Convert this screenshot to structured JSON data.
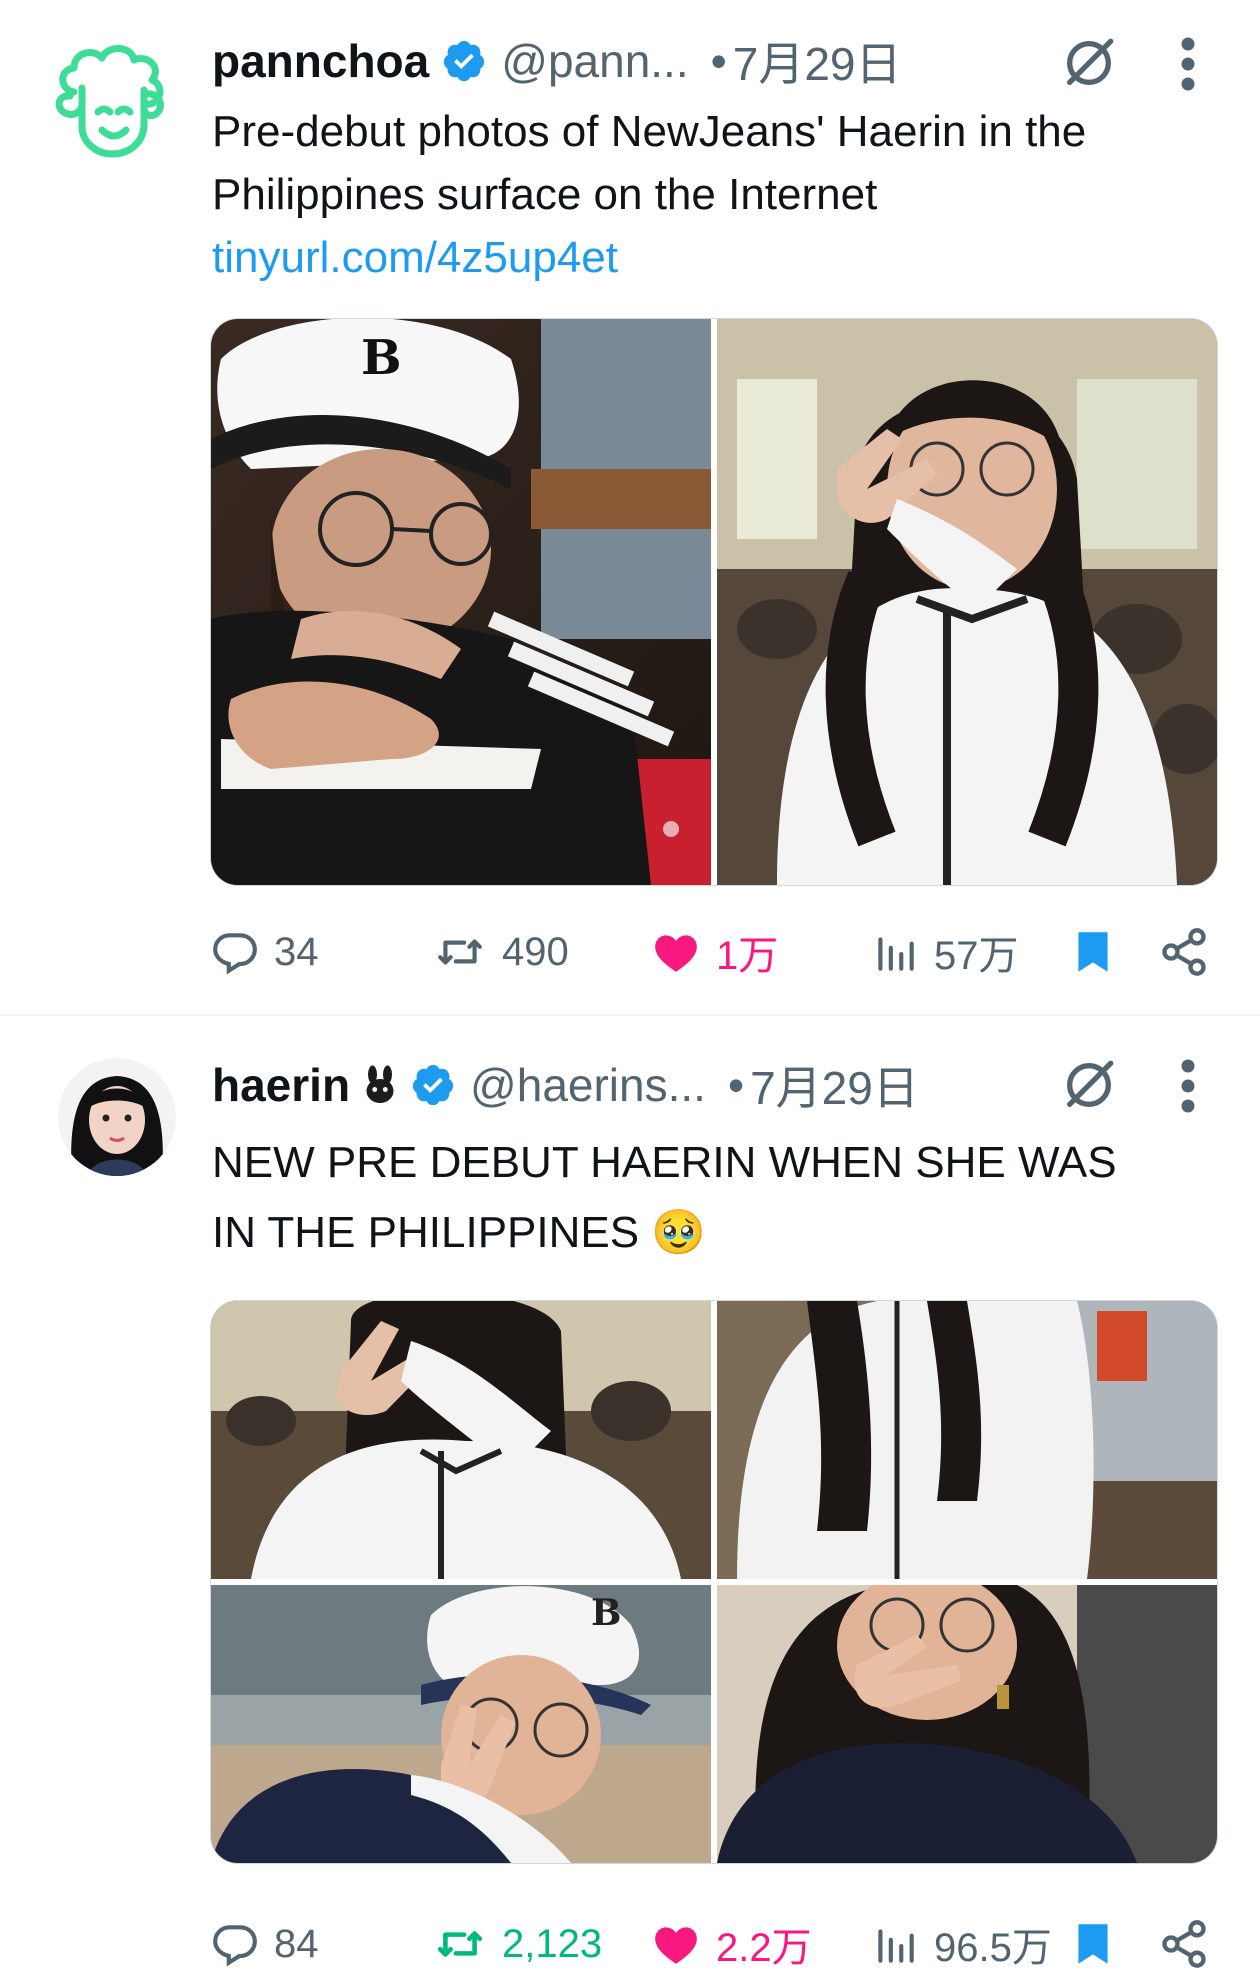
{
  "tweets": [
    {
      "name": "pannchoa",
      "handle": "@pann...",
      "dot": "•",
      "date": "7月29日",
      "text": "Pre-debut photos of NewJeans' Haerin in the Philippines surface on the Internet",
      "link": "tinyurl.com/4z5up4et",
      "photos": [
        "girl-in-cap-writing",
        "girl-peace-sign-cafeteria"
      ],
      "replies": "34",
      "retweets": "490",
      "likes": "1万",
      "views": "57万"
    },
    {
      "name": "haerin",
      "handle": "@haerins...",
      "dot": "•",
      "date": "7月29日",
      "text": "NEW PRE DEBUT HAERIN WHEN SHE WAS IN THE PHILIPPINES",
      "emoji": "🥹",
      "photos": [
        "peace-sign-cafeteria",
        "white-jacket-closeup",
        "cap-peace-sign-beach",
        "glasses-peace-sign"
      ],
      "replies": "84",
      "retweets": "2,123",
      "likes": "2.2万",
      "views": "96.5万"
    }
  ],
  "colors": {
    "link": "#1d9bf0",
    "verified": "#1d9bf0",
    "liked": "#f91880",
    "retweeted": "#00ba7c",
    "bookmarked": "#1d9bf0",
    "secondary": "#536471",
    "logo": "#3ddc97"
  }
}
